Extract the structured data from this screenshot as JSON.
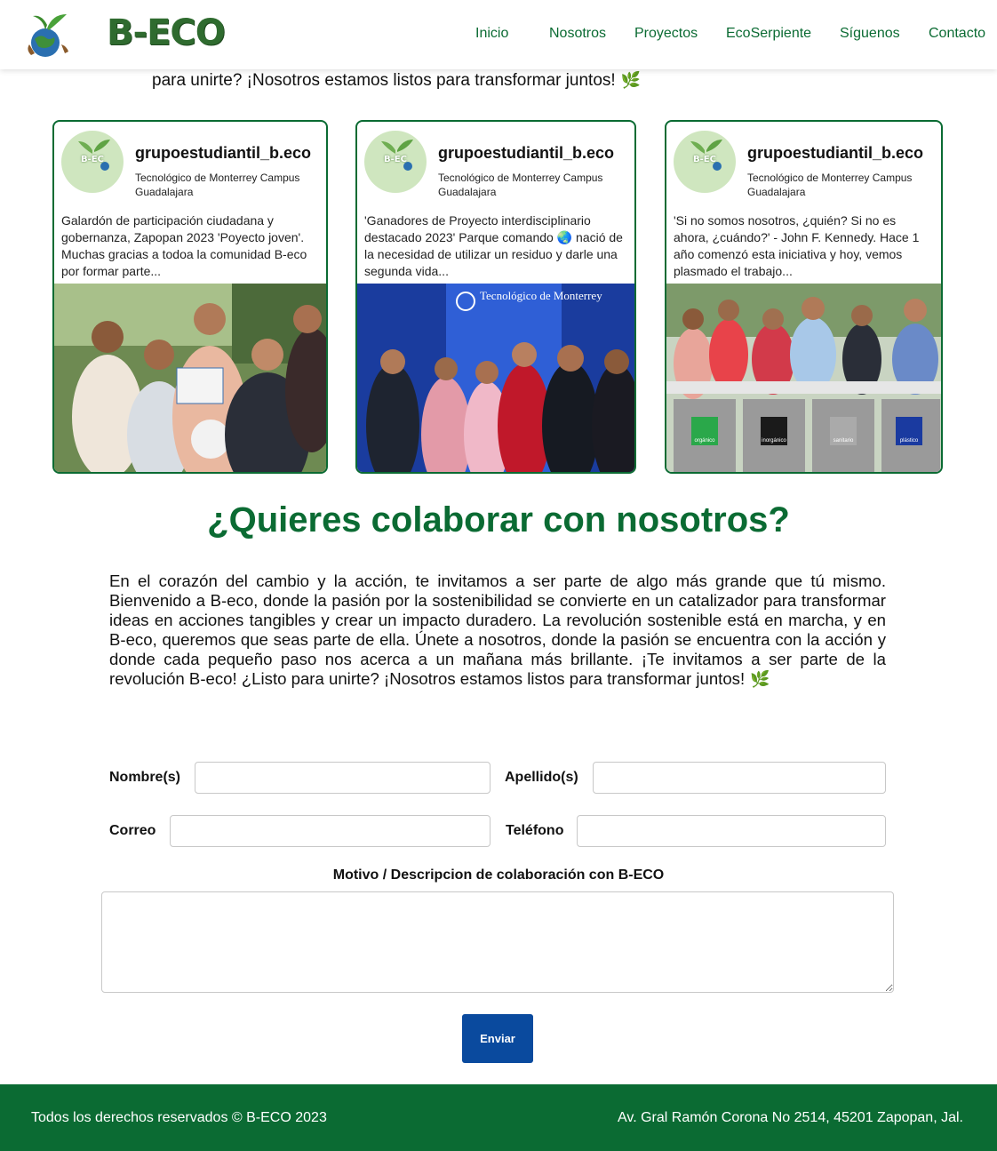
{
  "header": {
    "brand": "B-ECO",
    "nav": [
      {
        "label": "Inicio"
      },
      {
        "label": "Nosotros"
      },
      {
        "label": "Proyectos"
      },
      {
        "label": "EcoSerpiente"
      },
      {
        "label": "Síguenos"
      },
      {
        "label": "Contacto"
      }
    ]
  },
  "intro_tail": "para unirte? ¡Nosotros estamos listos para transformar juntos!",
  "cards": [
    {
      "handle": "grupoestudiantil_b.eco",
      "avatar_text": "B-EC",
      "location": "Tecnológico de Monterrey Campus Guadalajara",
      "caption": "Galardón de participación ciudadana y gobernanza, Zapopan 2023 'Poyecto joven'. Muchas gracias a todoa la comunidad B-eco por formar parte..."
    },
    {
      "handle": "grupoestudiantil_b.eco",
      "avatar_text": "B-EC",
      "location": "Tecnológico de Monterrey Campus Guadalajara",
      "caption": "'Ganadores de Proyecto interdisciplinario destacado 2023' Parque comando 🌏 nació de la necesidad de utilizar un residuo y darle una segunda vida...",
      "photo_sign": "Tecnológico de Monterrey"
    },
    {
      "handle": "grupoestudiantil_b.eco",
      "avatar_text": "B-EC",
      "location": "Tecnológico de Monterrey Campus Guadalajara",
      "caption": "'Si no somos nosotros, ¿quién? Si no es ahora, ¿cuándo?' - John F. Kennedy. Hace 1 año comenzó esta iniciativa y hoy, vemos plasmado el trabajo...",
      "bins": [
        "orgánico",
        "inorgánico",
        "sanitario",
        "plástico"
      ]
    }
  ],
  "collab": {
    "title": "¿Quieres colaborar con nosotros?",
    "text": "En el corazón del cambio y la acción, te invitamos a ser parte de algo más grande que tú mismo. Bienvenido a B-eco, donde la pasión por la sostenibilidad se convierte en un catalizador para transformar ideas en acciones tangibles y crear un impacto duradero. La revolución sostenible está en marcha, y en B-eco, queremos que seas parte de ella. Únete a nosotros, donde la pasión se encuentra con la acción y donde cada pequeño paso nos acerca a un mañana más brillante. ¡Te invitamos a ser parte de la revolución B-eco! ¿Listo para unirte? ¡Nosotros estamos listos para transformar juntos!"
  },
  "form": {
    "nombre_label": "Nombre(s)",
    "nombre_value": "",
    "apellido_label": "Apellido(s)",
    "apellido_value": "",
    "correo_label": "Correo",
    "correo_value": "",
    "telefono_label": "Teléfono",
    "telefono_value": "",
    "motivo_label": "Motivo / Descripcion de colaboración con B-ECO",
    "motivo_value": "",
    "submit_label": "Enviar"
  },
  "footer": {
    "left": "Todos los derechos reservados © B-ECO 2023",
    "right": "Av. Gral Ramón Corona No 2514, 45201 Zapopan, Jal."
  },
  "colors": {
    "brand_green": "#0b6b33",
    "button_blue": "#0a4a9e"
  }
}
